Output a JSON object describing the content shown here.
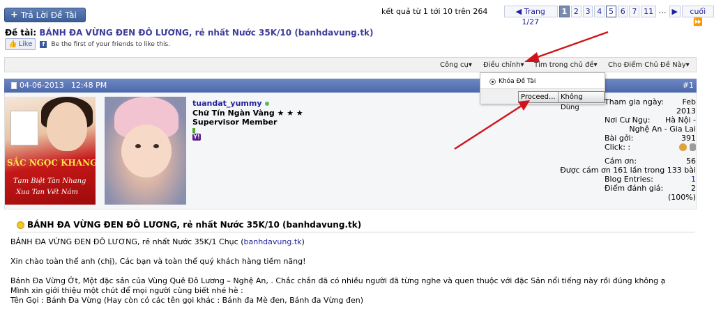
{
  "top": {
    "reply_button": "Trả Lời Đề Tài",
    "results_text": "kết quả từ 1 tới 10 trên 264",
    "pagination": {
      "prev": "◀",
      "label": "Trang 1/27",
      "pages": [
        "1",
        "2",
        "3",
        "4",
        "5",
        "6",
        "7",
        "11"
      ],
      "ellipsis": "…",
      "next": "▶",
      "last": "cuối"
    }
  },
  "thread": {
    "title_prefix": "Đề tài:",
    "title": "BÁNH ĐA VỪNG ĐEN ĐÔ LƯƠNG, rẻ nhất Nước 35K/10 (banhdavung.tk)",
    "like_label": "Like",
    "like_text": "Be the first of your friends to like this."
  },
  "toolbar": {
    "tools": "Công cụ",
    "adjust": "Điều chỉnh",
    "search_thread": "Tìm trong chủ đề",
    "rate_thread": "Cho Điểm Chủ Đề Này"
  },
  "dropdown": {
    "option_lock": "Khóa Đề Tài",
    "proceed": "Proceed...",
    "cancel": "Không Dùng"
  },
  "post": {
    "date": "04-06-2013",
    "time": "12:48 PM",
    "number": "#1",
    "banner": {
      "brand": "SẮC NGỌC KHANG",
      "tagline1": "Tạm Biệt Tàn Nhang",
      "tagline2": "Xua Tan Vết Nám"
    },
    "user": {
      "username": "tuandat_yummy",
      "title": "Chữ Tín Ngàn Vàng ★ ★ ★",
      "rank": "Supervisor Member",
      "yahoo": "Y!"
    },
    "stats": {
      "join_label": "Tham gia ngày:",
      "join_month": "Feb",
      "join_year": "2013",
      "location_label": "Nơi Cư Ngụ:",
      "location_1": "Hà Nội -",
      "location_2": "Nghệ An - Gia Lai",
      "posts_label": "Bài gởi:",
      "posts_value": "391",
      "click_label": "Click: :",
      "thanks_label": "Cám ơn:",
      "thanks_value": "56",
      "thanked_text": "Được cám ơn 161 lần trong 133 bài",
      "blog_label": "Blog Entries:",
      "blog_value": "1",
      "rating_label": "Điểm đánh giá:",
      "rating_value": "2",
      "rating_pct": "(100%)"
    },
    "post_title": "BÁNH ĐA VỪNG ĐEN ĐÔ LƯƠNG, rẻ nhất Nước 35K/10 (banhdavung.tk)",
    "line1_pre": "BÁNH ĐA VỪNG ĐEN ĐÔ LƯƠNG, rẻ nhất Nước 35K/1 Chục (",
    "line1_link": "banhdavung.tk",
    "line1_post": ")",
    "line2": "Xin chào toàn thể anh (chị), Các bạn và toàn thể quý khách hàng tiềm năng!",
    "line3": "Bánh Đa Vừng Ớt, Một đặc sản của Vùng Quê Đô Lương – Nghệ An, . Chắc chắn đã có nhiều người đã từng nghe và quen thuộc với đặc Sản nổi tiếng này rồi đúng không ạ",
    "line4": "Mình xin giới thiệu một chút để mọi người cùng biết nhé hè :",
    "line5": "Tên Gọi : Bánh Đa Vừng (Hay còn có các tên gọi khác : Bánh đa Mè đen, Bánh đa Vừng đen)"
  },
  "colors": {
    "link": "#22229c",
    "header_bar": "#5a74b5",
    "arrow": "#d0141a"
  }
}
